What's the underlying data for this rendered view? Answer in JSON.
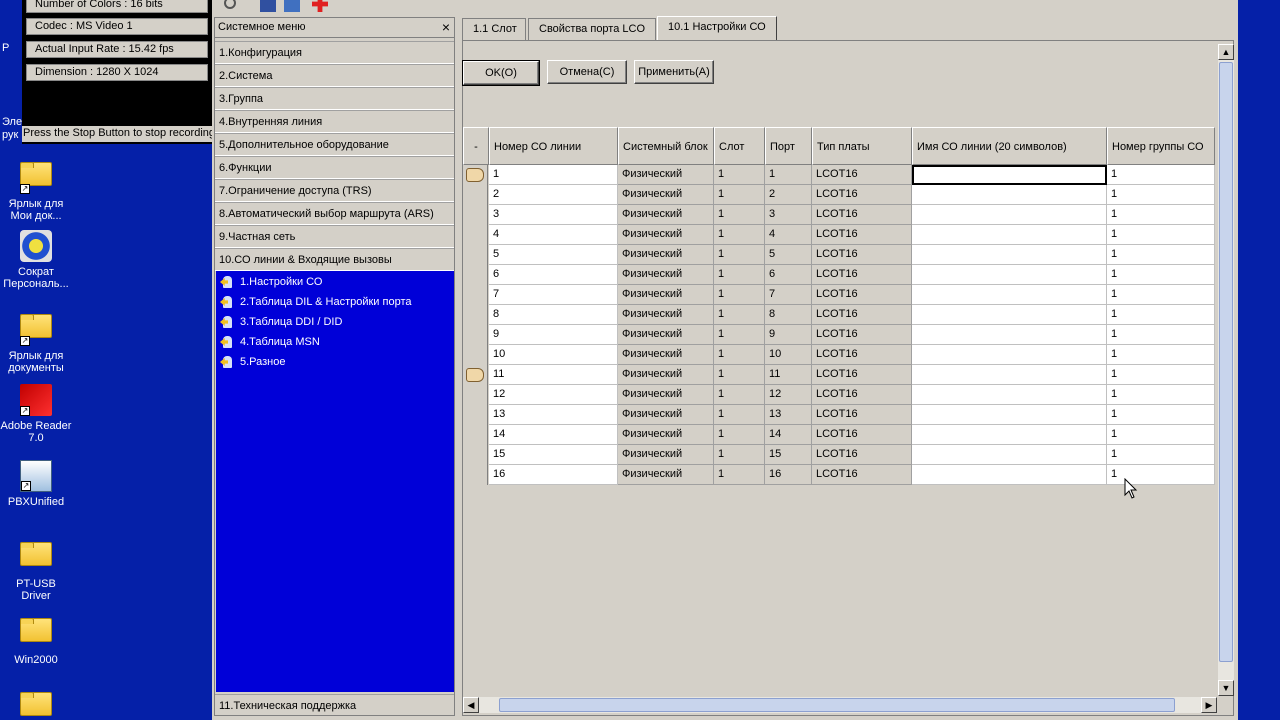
{
  "recorder": {
    "lines": [
      "Number of Colors : 16 bits",
      "Codec : MS Video 1",
      "Actual Input Rate : 15.42 fps",
      "Dimension : 1280 X 1024"
    ],
    "message": "Press the Stop Button to stop recording"
  },
  "desktop": {
    "edge_text": [
      "P",
      "Эле",
      "рук"
    ],
    "icons": [
      {
        "label": "Ярлык для Мои док...",
        "icon": "folder-shortcut-icon"
      },
      {
        "label": "Сократ Персональ...",
        "icon": "app-icon"
      },
      {
        "label": "Ярлык для документы",
        "icon": "folder-shortcut-icon"
      },
      {
        "label": "Adobe Reader 7.0",
        "icon": "pdf-icon"
      },
      {
        "label": "PBXUnified",
        "icon": "app-icon"
      },
      {
        "label": "PT-USB Driver",
        "icon": "folder-icon"
      },
      {
        "label": "Win2000",
        "icon": "folder-icon"
      },
      {
        "label": "",
        "icon": "folder-icon"
      }
    ]
  },
  "sysmenu": {
    "title": "Системное меню",
    "items": [
      "1.Конфигурация",
      "2.Система",
      "3.Группа",
      "4.Внутренняя линия",
      "5.Дополнительное оборудование",
      "6.Функции",
      "7.Ограничение доступа (TRS)",
      "8.Автоматический выбор маршрута (ARS)",
      "9.Частная сеть",
      "10.СО линии & Входящие вызовы"
    ],
    "subitems": [
      "1.Настройки СО",
      "2.Таблица DIL & Настройки порта",
      "3.Таблица DDI / DID",
      "4.Таблица MSN",
      "5.Разное"
    ],
    "last_item": "11.Техническая поддержка"
  },
  "tabs": [
    "1.1 Слот",
    "Свойства порта LCO",
    "10.1 Настройки СО"
  ],
  "buttons": {
    "ok": "OK(O)",
    "cancel": "Отмена(C)",
    "apply": "Применить(A)"
  },
  "grid": {
    "corner": "-",
    "columns": [
      "Номер СО линии",
      "Системный блок",
      "Слот",
      "Порт",
      "Тип платы",
      "Имя СО линии (20 символов)",
      "Номер группы СО"
    ],
    "rows": [
      [
        "1",
        "Физический",
        "1",
        "1",
        "LCOT16",
        "",
        "1"
      ],
      [
        "2",
        "Физический",
        "1",
        "2",
        "LCOT16",
        "",
        "1"
      ],
      [
        "3",
        "Физический",
        "1",
        "3",
        "LCOT16",
        "",
        "1"
      ],
      [
        "4",
        "Физический",
        "1",
        "4",
        "LCOT16",
        "",
        "1"
      ],
      [
        "5",
        "Физический",
        "1",
        "5",
        "LCOT16",
        "",
        "1"
      ],
      [
        "6",
        "Физический",
        "1",
        "6",
        "LCOT16",
        "",
        "1"
      ],
      [
        "7",
        "Физический",
        "1",
        "7",
        "LCOT16",
        "",
        "1"
      ],
      [
        "8",
        "Физический",
        "1",
        "8",
        "LCOT16",
        "",
        "1"
      ],
      [
        "9",
        "Физический",
        "1",
        "9",
        "LCOT16",
        "",
        "1"
      ],
      [
        "10",
        "Физический",
        "1",
        "10",
        "LCOT16",
        "",
        "1"
      ],
      [
        "11",
        "Физический",
        "1",
        "11",
        "LCOT16",
        "",
        "1"
      ],
      [
        "12",
        "Физический",
        "1",
        "12",
        "LCOT16",
        "",
        "1"
      ],
      [
        "13",
        "Физический",
        "1",
        "13",
        "LCOT16",
        "",
        "1"
      ],
      [
        "14",
        "Физический",
        "1",
        "14",
        "LCOT16",
        "",
        "1"
      ],
      [
        "15",
        "Физический",
        "1",
        "15",
        "LCOT16",
        "",
        "1"
      ],
      [
        "16",
        "Физический",
        "1",
        "16",
        "LCOT16",
        "",
        "1"
      ]
    ]
  }
}
